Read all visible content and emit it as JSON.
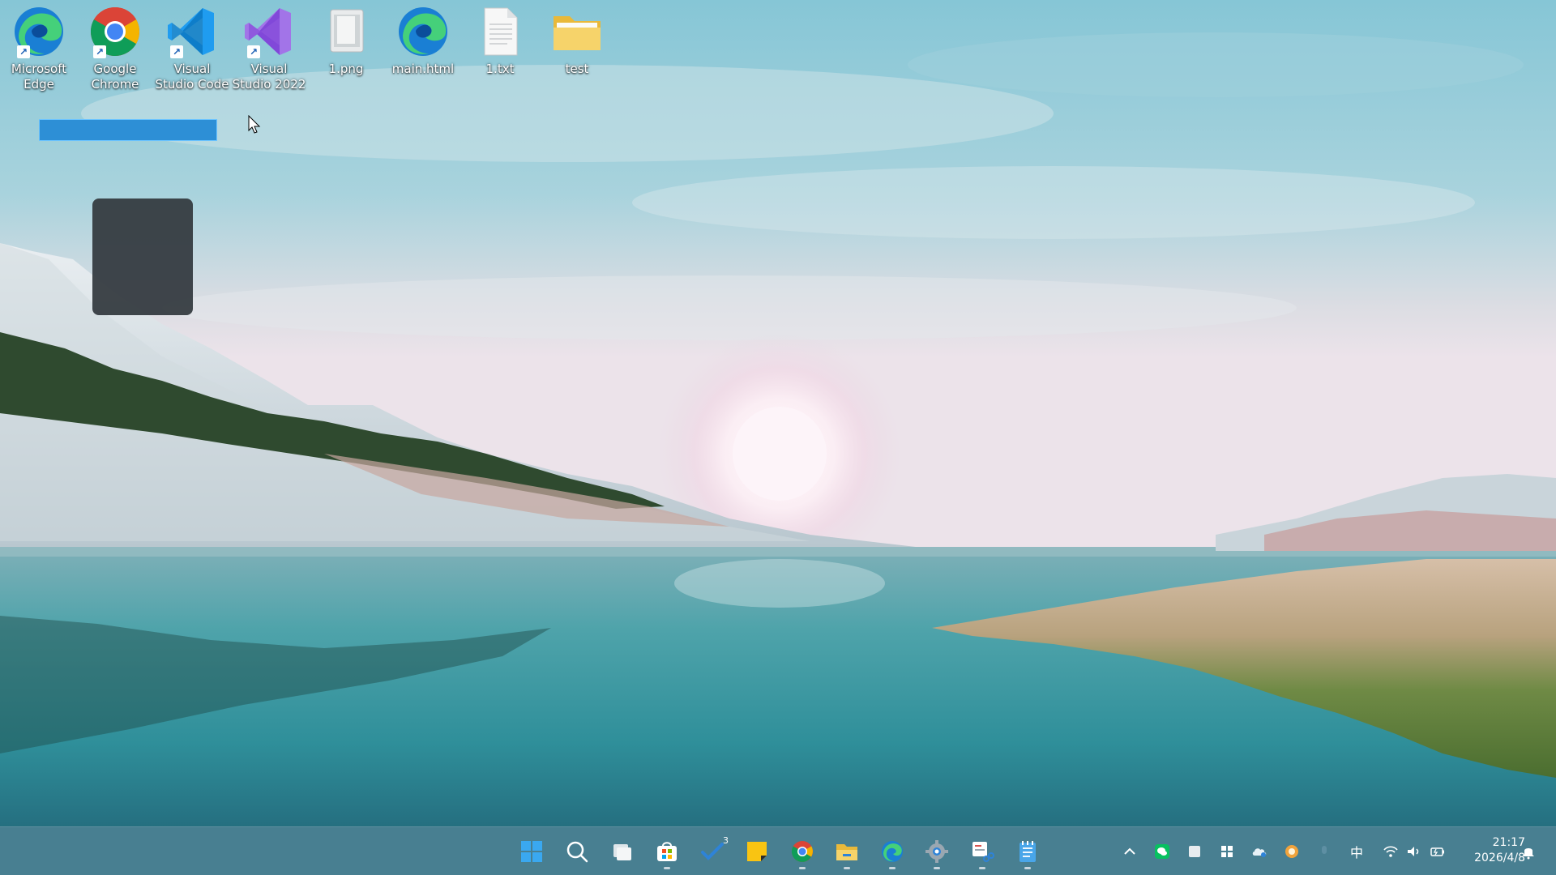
{
  "desktop": {
    "icons": [
      {
        "name": "microsoft-edge",
        "label": "Microsoft\nEdge",
        "icon": "edge-icon",
        "shortcut": true
      },
      {
        "name": "google-chrome",
        "label": "Google\nChrome",
        "icon": "chrome-icon",
        "shortcut": true
      },
      {
        "name": "visual-studio-code",
        "label": "Visual\nStudio Code",
        "icon": "vscode-icon",
        "shortcut": true
      },
      {
        "name": "visual-studio-2022",
        "label": "Visual\nStudio 2022",
        "icon": "visual-studio-icon",
        "shortcut": true
      },
      {
        "name": "1-png",
        "label": "1.png",
        "icon": "image-file-icon",
        "shortcut": false
      },
      {
        "name": "main-html",
        "label": "main.html",
        "icon": "edge-html-icon",
        "shortcut": false
      },
      {
        "name": "1-txt",
        "label": "1.txt",
        "icon": "text-file-icon",
        "shortcut": false
      },
      {
        "name": "test",
        "label": "test",
        "icon": "folder-icon",
        "shortcut": false
      }
    ],
    "rename_value": ""
  },
  "taskbar": {
    "apps": [
      {
        "name": "start",
        "icon": "windows-start-icon"
      },
      {
        "name": "search",
        "icon": "search-icon"
      },
      {
        "name": "task-view",
        "icon": "task-view-icon"
      },
      {
        "name": "microsoft-store",
        "icon": "store-icon"
      },
      {
        "name": "todo",
        "icon": "todo-check-icon",
        "badge": "3"
      },
      {
        "name": "sticky-notes",
        "icon": "sticky-notes-icon"
      },
      {
        "name": "chrome",
        "icon": "chrome-icon"
      },
      {
        "name": "file-explorer",
        "icon": "folder-icon"
      },
      {
        "name": "edge",
        "icon": "edge-icon"
      },
      {
        "name": "settings",
        "icon": "gear-icon"
      },
      {
        "name": "snipping-tool",
        "icon": "snipping-tool-icon"
      },
      {
        "name": "notepad",
        "icon": "notepad-icon"
      }
    ],
    "tray": {
      "overflow_icon": "chevron-up-icon",
      "ime": "中",
      "time": "21:17",
      "date": "2026/4/8"
    }
  },
  "colors": {
    "rename_fill": "#2d8fd6",
    "taskbar_bg": "rgba(40,82,100,0.55)",
    "sky_top": "#7ec3d6",
    "water": "#2f8f9a"
  }
}
